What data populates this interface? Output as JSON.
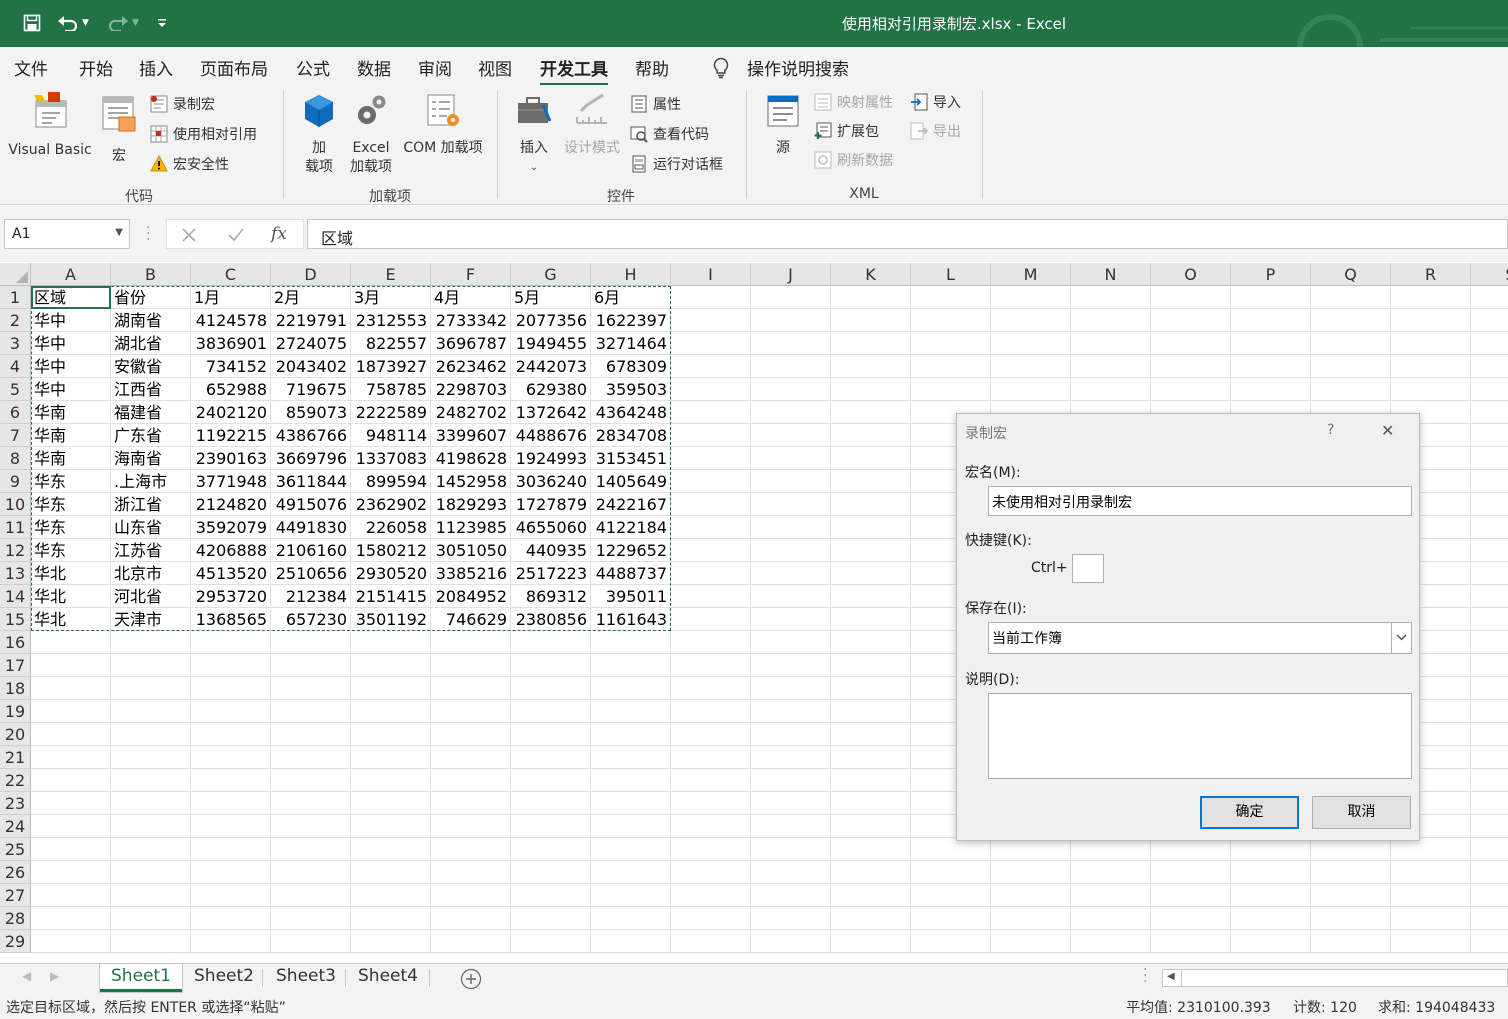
{
  "window": {
    "title": "使用相对引用录制宏.xlsx  -  Excel",
    "brand_color": "#217346"
  },
  "quick_access": {
    "icons": [
      "save-icon",
      "undo-icon",
      "redo-icon",
      "customize-icon"
    ]
  },
  "menu": {
    "tabs": [
      "文件",
      "开始",
      "插入",
      "页面布局",
      "公式",
      "数据",
      "审阅",
      "视图",
      "开发工具",
      "帮助"
    ],
    "active": "开发工具",
    "tell_me": "操作说明搜索"
  },
  "ribbon": {
    "code": {
      "label": "代码",
      "visual_basic": "Visual Basic",
      "macros": "宏",
      "record_macro": "录制宏",
      "use_relative": "使用相对引用",
      "macro_security": "宏安全性"
    },
    "addins": {
      "label": "加载项",
      "addins_line1": "加",
      "addins_line2": "载项",
      "excel_line1": "Excel",
      "excel_line2": "加载项",
      "com": "COM 加载项"
    },
    "controls": {
      "label": "控件",
      "insert": "插入",
      "design_mode": "设计模式",
      "properties": "属性",
      "view_code": "查看代码",
      "run_dialog": "运行对话框"
    },
    "xml": {
      "label": "XML",
      "source": "源",
      "map_properties": "映射属性",
      "expansion_packs": "扩展包",
      "refresh_data": "刷新数据",
      "import": "导入",
      "export": "导出"
    }
  },
  "formula_bar": {
    "name_box": "A1",
    "formula": "区域",
    "fx": "fx"
  },
  "sheet": {
    "columns": [
      "A",
      "B",
      "C",
      "D",
      "E",
      "F",
      "G",
      "H",
      "I",
      "J",
      "K",
      "L",
      "M",
      "N",
      "O",
      "P",
      "Q",
      "R",
      "S"
    ],
    "row_numbers": [
      1,
      2,
      3,
      4,
      5,
      6,
      7,
      8,
      9,
      10,
      11,
      12,
      13,
      14,
      15,
      16,
      17,
      18,
      19,
      20,
      21,
      22,
      23,
      24,
      25,
      26,
      27,
      28,
      29
    ],
    "rows": [
      [
        "区域",
        "省份",
        "1月",
        "2月",
        "3月",
        "4月",
        "5月",
        "6月"
      ],
      [
        "华中",
        "湖南省",
        "4124578",
        "2219791",
        "2312553",
        "2733342",
        "2077356",
        "1622397"
      ],
      [
        "华中",
        "湖北省",
        "3836901",
        "2724075",
        "822557",
        "3696787",
        "1949455",
        "3271464"
      ],
      [
        "华中",
        "安徽省",
        "734152",
        "2043402",
        "1873927",
        "2623462",
        "2442073",
        "678309"
      ],
      [
        "华中",
        "江西省",
        "652988",
        "719675",
        "758785",
        "2298703",
        "629380",
        "359503"
      ],
      [
        "华南",
        "福建省",
        "2402120",
        "859073",
        "2222589",
        "2482702",
        "1372642",
        "4364248"
      ],
      [
        "华南",
        "广东省",
        "1192215",
        "4386766",
        "948114",
        "3399607",
        "4488676",
        "2834708"
      ],
      [
        "华南",
        "海南省",
        "2390163",
        "3669796",
        "1337083",
        "4198628",
        "1924993",
        "3153451"
      ],
      [
        "华东",
        ".上海市",
        "3771948",
        "3611844",
        "899594",
        "1452958",
        "3036240",
        "1405649"
      ],
      [
        "华东",
        "浙江省",
        "2124820",
        "4915076",
        "2362902",
        "1829293",
        "1727879",
        "2422167"
      ],
      [
        "华东",
        "山东省",
        "3592079",
        "4491830",
        "226058",
        "1123985",
        "4655060",
        "4122184"
      ],
      [
        "华东",
        "江苏省",
        "4206888",
        "2106160",
        "1580212",
        "3051050",
        "440935",
        "1229652"
      ],
      [
        "华北",
        "北京市",
        "4513520",
        "2510656",
        "2930520",
        "3385216",
        "2517223",
        "4488737"
      ],
      [
        "华北",
        "河北省",
        "2953720",
        "212384",
        "2151415",
        "2084952",
        "869312",
        "395011"
      ],
      [
        "华北",
        "天津市",
        "1368565",
        "657230",
        "3501192",
        "746629",
        "2380856",
        "1161643"
      ]
    ]
  },
  "sheet_tabs": {
    "tabs": [
      "Sheet1",
      "Sheet2",
      "Sheet3",
      "Sheet4"
    ],
    "active": "Sheet1"
  },
  "status": {
    "message": "选定目标区域，然后按 ENTER 或选择“粘贴”",
    "average": "平均值: 2310100.393",
    "count": "计数: 120",
    "sum": "求和: 194048433"
  },
  "dialog": {
    "title": "录制宏",
    "help": "?",
    "close": "✕",
    "name_label": "宏名(M):",
    "name_value": "未使用相对引用录制宏",
    "shortcut_label": "快捷键(K):",
    "ctrl_label": "Ctrl+",
    "shortcut_value": "",
    "store_label": "保存在(I):",
    "store_value": "当前工作簿",
    "desc_label": "说明(D):",
    "desc_value": "",
    "ok": "确定",
    "cancel": "取消"
  }
}
